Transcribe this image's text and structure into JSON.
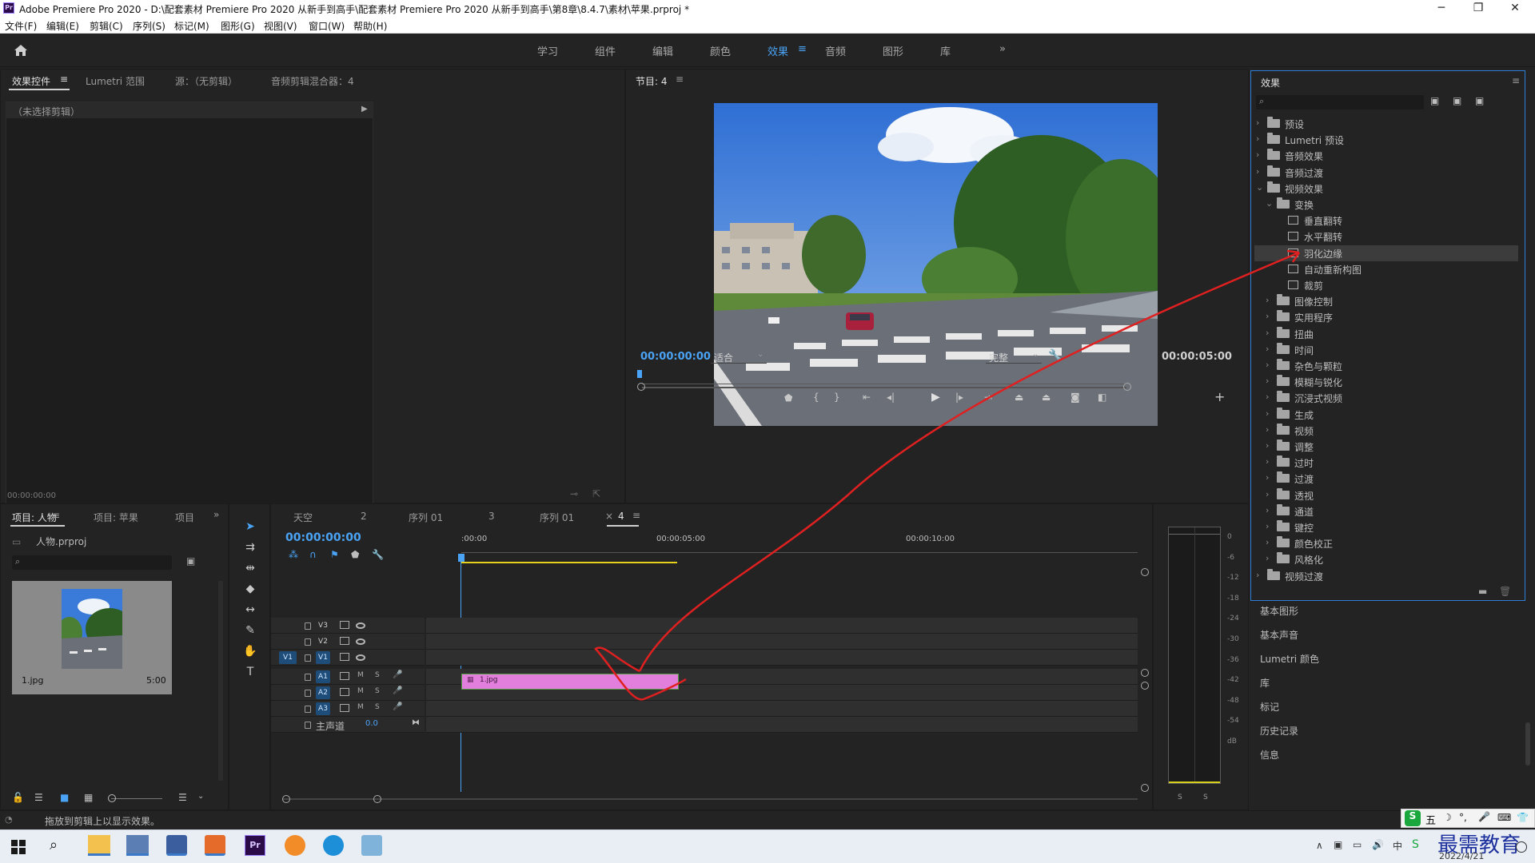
{
  "window": {
    "title": "Adobe Premiere Pro 2020 - D:\\配套素材 Premiere Pro 2020 从新手到高手\\配套素材 Premiere Pro 2020 从新手到高手\\第8章\\8.4.7\\素材\\苹果.prproj *",
    "app_icon": "Pr",
    "controls": [
      "─",
      "❐",
      "✕"
    ]
  },
  "menu": [
    "文件(F)",
    "编辑(E)",
    "剪辑(C)",
    "序列(S)",
    "标记(M)",
    "图形(G)",
    "视图(V)",
    "窗口(W)",
    "帮助(H)"
  ],
  "workspaces": {
    "items": [
      "学习",
      "组件",
      "编辑",
      "颜色",
      "效果",
      "音频",
      "图形",
      "库"
    ],
    "active": "效果",
    "more": "»"
  },
  "source_panel": {
    "tabs": [
      "效果控件",
      "Lumetri 范围",
      "源：（无剪辑）",
      "音频剪辑混合器：4"
    ],
    "menu_glyph": "≡",
    "no_clip": "（未选择剪辑）",
    "timecode": "00:00:00:00"
  },
  "program_panel": {
    "title": "节目: 4",
    "timecode_left": "00:00:00:00",
    "fit": "适合",
    "quality": "完整",
    "timecode_right": "00:00:05:00"
  },
  "effects_panel": {
    "title": "效果",
    "tree": [
      {
        "label": "预设",
        "level": 0,
        "type": "folder",
        "expanded": false
      },
      {
        "label": "Lumetri 预设",
        "level": 0,
        "type": "folder",
        "expanded": false
      },
      {
        "label": "音频效果",
        "level": 0,
        "type": "folder",
        "expanded": false
      },
      {
        "label": "音频过渡",
        "level": 0,
        "type": "folder",
        "expanded": false
      },
      {
        "label": "视频效果",
        "level": 0,
        "type": "folder",
        "expanded": true
      },
      {
        "label": "变换",
        "level": 1,
        "type": "folder",
        "expanded": true
      },
      {
        "label": "垂直翻转",
        "level": 2,
        "type": "fx"
      },
      {
        "label": "水平翻转",
        "level": 2,
        "type": "fx"
      },
      {
        "label": "羽化边缘",
        "level": 2,
        "type": "fx",
        "selected": true
      },
      {
        "label": "自动重新构图",
        "level": 2,
        "type": "fx"
      },
      {
        "label": "裁剪",
        "level": 2,
        "type": "fx"
      },
      {
        "label": "图像控制",
        "level": 1,
        "type": "folder",
        "expanded": false
      },
      {
        "label": "实用程序",
        "level": 1,
        "type": "folder",
        "expanded": false
      },
      {
        "label": "扭曲",
        "level": 1,
        "type": "folder",
        "expanded": false
      },
      {
        "label": "时间",
        "level": 1,
        "type": "folder",
        "expanded": false
      },
      {
        "label": "杂色与颗粒",
        "level": 1,
        "type": "folder",
        "expanded": false
      },
      {
        "label": "模糊与锐化",
        "level": 1,
        "type": "folder",
        "expanded": false
      },
      {
        "label": "沉浸式视频",
        "level": 1,
        "type": "folder",
        "expanded": false
      },
      {
        "label": "生成",
        "level": 1,
        "type": "folder",
        "expanded": false
      },
      {
        "label": "视频",
        "level": 1,
        "type": "folder",
        "expanded": false
      },
      {
        "label": "调整",
        "level": 1,
        "type": "folder",
        "expanded": false
      },
      {
        "label": "过时",
        "level": 1,
        "type": "folder",
        "expanded": false
      },
      {
        "label": "过渡",
        "level": 1,
        "type": "folder",
        "expanded": false
      },
      {
        "label": "透视",
        "level": 1,
        "type": "folder",
        "expanded": false
      },
      {
        "label": "通道",
        "level": 1,
        "type": "folder",
        "expanded": false
      },
      {
        "label": "键控",
        "level": 1,
        "type": "folder",
        "expanded": false
      },
      {
        "label": "颜色校正",
        "level": 1,
        "type": "folder",
        "expanded": false
      },
      {
        "label": "风格化",
        "level": 1,
        "type": "folder",
        "expanded": false
      },
      {
        "label": "视频过渡",
        "level": 0,
        "type": "folder",
        "expanded": false
      }
    ]
  },
  "side_panels": [
    "基本图形",
    "基本声音",
    "Lumetri 颜色",
    "库",
    "标记",
    "历史记录",
    "信息"
  ],
  "project_panel": {
    "tabs": [
      "项目: 人物",
      "项目: 苹果",
      "项目"
    ],
    "folder": "人物.prproj",
    "clip_name": "1.jpg",
    "clip_duration": "5:00"
  },
  "timeline": {
    "tabs": [
      "天空",
      "2",
      "序列 01",
      "3",
      "序列 01",
      "4"
    ],
    "close_glyph": "×",
    "timecode": "00:00:00:00",
    "ruler": [
      ":00:00",
      "00:00:05:00",
      "00:00:10:00"
    ],
    "video_tracks": [
      "V3",
      "V2",
      "V1"
    ],
    "audio_tracks": [
      "A1",
      "A2",
      "A3"
    ],
    "master_label": "主声道",
    "master_value": "0.0",
    "clip_label": "1.jpg",
    "source_patch": "V1",
    "mute": "M",
    "solo": "S"
  },
  "meter_scale": [
    "0",
    "-6",
    "-12",
    "-18",
    "-24",
    "-30",
    "-36",
    "-42",
    "-48",
    "-54",
    "dB"
  ],
  "status_text": "拖放到剪辑上以显示效果。",
  "taskbar": {
    "time": "",
    "date": "2022/4/21",
    "watermark": "最需教育",
    "ime": "五"
  },
  "colors": {
    "accent": "#4aa3f5",
    "clip": "#e27fdc",
    "annotation": "#e02020"
  }
}
